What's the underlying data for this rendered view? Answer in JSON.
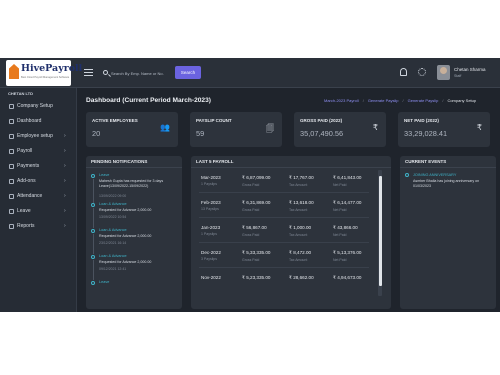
{
  "header": {
    "logo_text": "HivePayroll",
    "logo_tagline": "Best Cloud Payroll Management Software",
    "search_placeholder": "Search By Emp. Name or No.",
    "search_button": "Search",
    "user_name": "Chetan Sharma",
    "user_role": "Staff",
    "icons": [
      "menu-icon",
      "search-icon",
      "bell-icon",
      "gear-icon"
    ]
  },
  "sidebar": {
    "company": "CHETAN LTD",
    "items": [
      {
        "label": "Company Setup",
        "icon": "building-icon",
        "chevron": false
      },
      {
        "label": "Dashboard",
        "icon": "dashboard-icon",
        "chevron": false
      },
      {
        "label": "Employee setup",
        "icon": "users-icon",
        "chevron": true
      },
      {
        "label": "Payroll",
        "icon": "rupee-icon",
        "chevron": true
      },
      {
        "label": "Payments",
        "icon": "rupee-icon",
        "chevron": true
      },
      {
        "label": "Add-ons",
        "icon": "plug-icon",
        "chevron": true
      },
      {
        "label": "Attendance",
        "icon": "clock-icon",
        "chevron": true
      },
      {
        "label": "Leave",
        "icon": "calendar-icon",
        "chevron": true
      },
      {
        "label": "Reports",
        "icon": "chart-icon",
        "chevron": true
      }
    ]
  },
  "main": {
    "title": "Dashboard (Current Period March-2023)",
    "breadcrumbs": [
      "March-2023 Payroll",
      "Generate Payslip",
      "Generate Payslip",
      "Company Setup"
    ],
    "stats": [
      {
        "label": "ACTIVE EMPLOYEES",
        "value": "20",
        "icon": "people-icon",
        "glyph": "👥"
      },
      {
        "label": "PAYSLIP COUNT",
        "value": "59",
        "icon": "payslip-icon",
        "glyph": "🗐"
      },
      {
        "label": "GROSS PAID (2022)",
        "value": "35,07,490.56",
        "icon": "rupee-icon",
        "glyph": "₹"
      },
      {
        "label": "NET PAID (2022)",
        "value": "33,29,028.41",
        "icon": "rupee-icon",
        "glyph": "₹"
      }
    ],
    "notifications": {
      "title": "PENDING NOTIFICATIONS",
      "items": [
        {
          "type": "Leave",
          "text": "Mahesh Gupta has requested for 3 days Leave(13/09/2022-15/09/2022)",
          "date": "13/09/2022 09:00"
        },
        {
          "type": "Loan & Advance",
          "text": "Requested for Advance 2,000.00",
          "date": "13/09/2022 10:54"
        },
        {
          "type": "Loan & Advance",
          "text": "Requested for Advance 2,000.00",
          "date": "23/12/2021 16:14"
        },
        {
          "type": "Loan & Advance",
          "text": "Requested for Advance 2,000.00",
          "date": "09/12/2021 12:41"
        },
        {
          "type": "Leave",
          "text": "",
          "date": ""
        }
      ]
    },
    "payroll": {
      "title": "LAST 5 PAYROLL",
      "rows": [
        {
          "period": "Mar-2023",
          "payslips": "1 Payslips",
          "gross": "₹ 6,87,099.00",
          "gross_label": "Gross Paid",
          "tax": "₹ 17,767.00",
          "tax_label": "Tax Amount",
          "net": "₹ 6,41,843.00",
          "net_label": "Net Paid"
        },
        {
          "period": "Feb-2023",
          "payslips": "13 Payslips",
          "gross": "₹ 6,31,869.00",
          "gross_label": "Gross Paid",
          "tax": "₹ 13,618.00",
          "tax_label": "Tax Amount",
          "net": "₹ 6,14,477.00",
          "net_label": "Net Paid"
        },
        {
          "period": "Jan-2023",
          "payslips": "1 Payslips",
          "gross": "₹ 56,867.00",
          "gross_label": "Gross Paid",
          "tax": "₹ 1,000.00",
          "tax_label": "Tax Amount",
          "net": "₹ 43,866.00",
          "net_label": "Net Paid"
        },
        {
          "period": "Dec-2022",
          "payslips": "3 Payslips",
          "gross": "₹ 5,33,335.00",
          "gross_label": "Gross Paid",
          "tax": "₹ 8,472.00",
          "tax_label": "Tax Amount",
          "net": "₹ 5,13,376.00",
          "net_label": "Net Paid"
        },
        {
          "period": "Nov-2022",
          "payslips": "",
          "gross": "₹ 5,23,335.00",
          "gross_label": "",
          "tax": "₹ 28,662.00",
          "tax_label": "",
          "net": "₹ 4,94,673.00",
          "net_label": ""
        }
      ]
    },
    "events": {
      "title": "CURRENT EVENTS",
      "items": [
        {
          "type": "JOINING ANNIVERSARY",
          "text": "Asmber Bhalla has joining anniversary on 01/03/2023"
        }
      ]
    }
  },
  "colors": {
    "background": "#1f242c",
    "panel": "#2d333c",
    "accent": "#6b63e0",
    "link": "#3fb4c9",
    "logo_orange": "#e87a1d"
  }
}
